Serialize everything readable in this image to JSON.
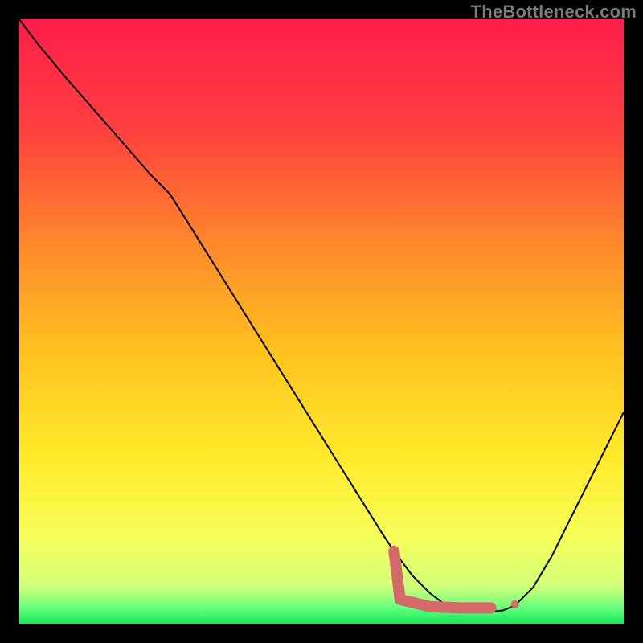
{
  "watermark": "TheBottleneck.com",
  "chart_data": {
    "type": "line",
    "title": "",
    "xlabel": "",
    "ylabel": "",
    "xlim": [
      0,
      100
    ],
    "ylim": [
      0,
      100
    ],
    "grid": false,
    "legend": false,
    "series": [
      {
        "name": "curve",
        "color": "#000000",
        "stroke_width": 2,
        "x": [
          0,
          3,
          8,
          15,
          22,
          25,
          30,
          35,
          40,
          45,
          50,
          55,
          60,
          62,
          65,
          68,
          70,
          72,
          74,
          76,
          78,
          80,
          82,
          85,
          88,
          92,
          96,
          100
        ],
        "values": [
          100,
          96,
          90,
          82,
          74,
          71,
          63,
          55,
          47,
          39,
          31,
          23,
          15,
          12,
          8,
          5,
          3.5,
          2.5,
          2,
          2,
          2,
          2.2,
          3,
          6,
          11,
          19,
          27,
          35
        ]
      },
      {
        "name": "highlight-bar",
        "color": "#d46a6a",
        "stroke_width": 14,
        "stroke_linecap": "round",
        "x": [
          62,
          63,
          68,
          73,
          76,
          78
        ],
        "values": [
          12,
          4,
          2.8,
          2.6,
          2.6,
          2.6
        ]
      },
      {
        "name": "highlight-dot",
        "color": "#d46a6a",
        "type": "scatter",
        "marker_radius": 5,
        "x": [
          82
        ],
        "values": [
          3.2
        ]
      }
    ],
    "background_gradient": {
      "stops": [
        {
          "offset": 0.0,
          "color": "#ff1d4a"
        },
        {
          "offset": 0.18,
          "color": "#ff3f3e"
        },
        {
          "offset": 0.38,
          "color": "#ff8b2a"
        },
        {
          "offset": 0.55,
          "color": "#ffc21f"
        },
        {
          "offset": 0.72,
          "color": "#ffe92a"
        },
        {
          "offset": 0.86,
          "color": "#f6ff5a"
        },
        {
          "offset": 0.94,
          "color": "#cfff7a"
        },
        {
          "offset": 0.975,
          "color": "#62ff7a"
        },
        {
          "offset": 1.0,
          "color": "#18e85a"
        }
      ]
    }
  }
}
